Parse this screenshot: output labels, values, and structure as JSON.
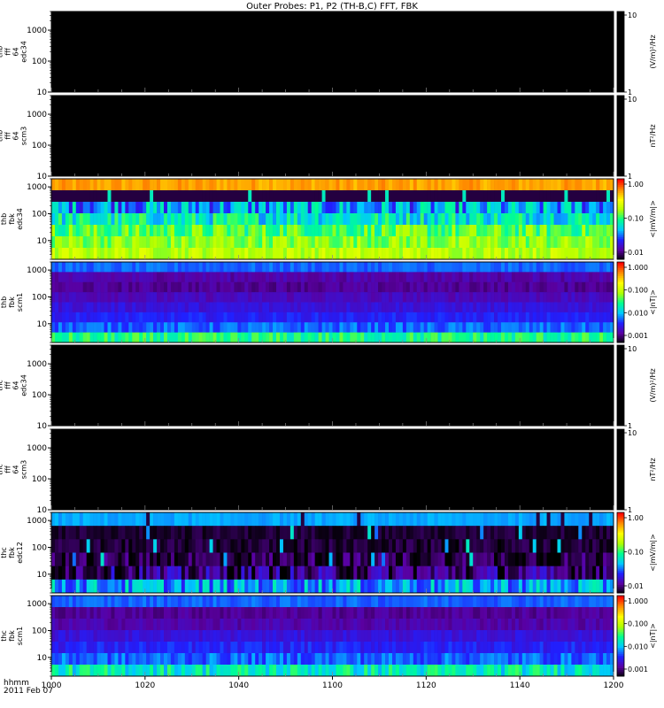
{
  "title": "Outer Probes: P1, P2 (TH-B,C) FFT, FBK",
  "time_axis": {
    "label_line1": "hhmm",
    "label_line2": "2011 Feb 07",
    "ticks": [
      "1000",
      "1020",
      "1040",
      "1100",
      "1120",
      "1140",
      "1200"
    ],
    "range_minutes": [
      600,
      720
    ]
  },
  "colormap": {
    "name": "rainbow",
    "stops": [
      "#000000",
      "#5a00a0",
      "#2020ff",
      "#00c8ff",
      "#00ff90",
      "#b0ff00",
      "#ffff00",
      "#ff8c00",
      "#ff0000"
    ]
  },
  "chart_data": [
    {
      "type": "heatmap",
      "ylabel": [
        "thb",
        "fff",
        "64",
        "edc34"
      ],
      "yticks": [
        "1000",
        "100",
        "10"
      ],
      "ylim": [
        10,
        4000
      ],
      "yscale": "log",
      "colorbar": {
        "title": "(V/m)²/Hz",
        "ticks": [
          "10",
          "1"
        ]
      },
      "pattern": "empty",
      "bands": []
    },
    {
      "type": "heatmap",
      "ylabel": [
        "thb",
        "fff",
        "64",
        "scm3"
      ],
      "yticks": [
        "1000",
        "100",
        "10"
      ],
      "ylim": [
        10,
        4000
      ],
      "yscale": "log",
      "colorbar": {
        "title": "nT²/Hz",
        "ticks": [
          "10",
          "1"
        ]
      },
      "pattern": "empty",
      "bands": []
    },
    {
      "type": "heatmap",
      "ylabel": [
        "thb",
        "fbk",
        "edc34"
      ],
      "yticks": [
        "1000",
        "100",
        "10"
      ],
      "ylim": [
        2,
        2000
      ],
      "yscale": "log",
      "colorbar": {
        "title": "<|mV/m|>",
        "ticks": [
          "1.00",
          "0.10",
          "0.01"
        ]
      },
      "pattern": "efield",
      "bands": [
        {
          "level": 0.85,
          "jitter": 0.04
        },
        {
          "level": 0.05,
          "jitter": 0.0
        },
        {
          "level": 0.35,
          "jitter": 0.15
        },
        {
          "level": 0.45,
          "jitter": 0.12
        },
        {
          "level": 0.55,
          "jitter": 0.1
        },
        {
          "level": 0.6,
          "jitter": 0.08
        },
        {
          "level": 0.65,
          "jitter": 0.06
        }
      ]
    },
    {
      "type": "heatmap",
      "ylabel": [
        "thb",
        "fbk",
        "scm1"
      ],
      "yticks": [
        "1000",
        "100",
        "10"
      ],
      "ylim": [
        2,
        2000
      ],
      "yscale": "log",
      "colorbar": {
        "title": "<|nT|>",
        "ticks": [
          "1.000",
          "0.100",
          "0.010",
          "0.001"
        ]
      },
      "pattern": "bfield",
      "bands": [
        {
          "level": 0.3,
          "jitter": 0.03
        },
        {
          "level": 0.14,
          "jitter": 0.03
        },
        {
          "level": 0.12,
          "jitter": 0.03
        },
        {
          "level": 0.16,
          "jitter": 0.03
        },
        {
          "level": 0.2,
          "jitter": 0.03
        },
        {
          "level": 0.24,
          "jitter": 0.03
        },
        {
          "level": 0.3,
          "jitter": 0.05
        },
        {
          "level": 0.5,
          "jitter": 0.08
        }
      ]
    },
    {
      "type": "heatmap",
      "ylabel": [
        "thc",
        "fff",
        "64",
        "edc34"
      ],
      "yticks": [
        "1000",
        "100",
        "10"
      ],
      "ylim": [
        10,
        4000
      ],
      "yscale": "log",
      "colorbar": {
        "title": "(V/m)²/Hz",
        "ticks": [
          "10",
          "1"
        ]
      },
      "pattern": "empty",
      "bands": []
    },
    {
      "type": "heatmap",
      "ylabel": [
        "thc",
        "fff",
        "64",
        "scm3"
      ],
      "yticks": [
        "1000",
        "100",
        "10"
      ],
      "ylim": [
        10,
        4000
      ],
      "yscale": "log",
      "colorbar": {
        "title": "nT²/Hz",
        "ticks": [
          "10",
          "1"
        ]
      },
      "pattern": "empty",
      "bands": []
    },
    {
      "type": "heatmap",
      "ylabel": [
        "thc",
        "fbk",
        "edc12"
      ],
      "yticks": [
        "1000",
        "100",
        "10"
      ],
      "ylim": [
        2,
        2000
      ],
      "yscale": "log",
      "colorbar": {
        "title": "<|mV/m|>",
        "ticks": [
          "1.00",
          "0.10",
          "0.01"
        ]
      },
      "pattern": "efield2",
      "bands": [
        {
          "level": 0.35,
          "jitter": 0.02
        },
        {
          "level": 0.04,
          "jitter": 0.03
        },
        {
          "level": 0.04,
          "jitter": 0.04
        },
        {
          "level": 0.06,
          "jitter": 0.08
        },
        {
          "level": 0.1,
          "jitter": 0.12
        },
        {
          "level": 0.35,
          "jitter": 0.12
        }
      ]
    },
    {
      "type": "heatmap",
      "ylabel": [
        "thc",
        "fbk",
        "scm1"
      ],
      "yticks": [
        "1000",
        "100",
        "10"
      ],
      "ylim": [
        2,
        2000
      ],
      "yscale": "log",
      "colorbar": {
        "title": "<|nT|>",
        "ticks": [
          "1.000",
          "0.100",
          "0.010",
          "0.001"
        ]
      },
      "pattern": "bfield2",
      "bands": [
        {
          "level": 0.3,
          "jitter": 0.03
        },
        {
          "level": 0.12,
          "jitter": 0.03
        },
        {
          "level": 0.14,
          "jitter": 0.03
        },
        {
          "level": 0.2,
          "jitter": 0.03
        },
        {
          "level": 0.24,
          "jitter": 0.04
        },
        {
          "level": 0.3,
          "jitter": 0.06
        },
        {
          "level": 0.45,
          "jitter": 0.1
        }
      ]
    }
  ]
}
